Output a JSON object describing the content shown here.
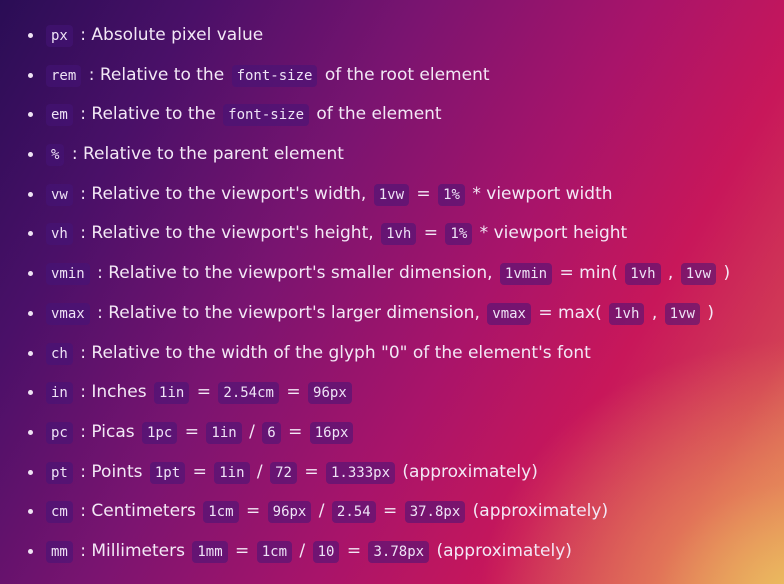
{
  "units": [
    {
      "parts": [
        {
          "t": "code",
          "v": "px"
        },
        {
          "t": "text",
          "v": " : Absolute pixel value"
        }
      ]
    },
    {
      "parts": [
        {
          "t": "code",
          "v": "rem"
        },
        {
          "t": "text",
          "v": " : Relative to the "
        },
        {
          "t": "code",
          "v": "font-size"
        },
        {
          "t": "text",
          "v": " of the root element"
        }
      ]
    },
    {
      "parts": [
        {
          "t": "code",
          "v": "em"
        },
        {
          "t": "text",
          "v": " : Relative to the "
        },
        {
          "t": "code",
          "v": "font-size"
        },
        {
          "t": "text",
          "v": " of the element"
        }
      ]
    },
    {
      "parts": [
        {
          "t": "code",
          "v": "%"
        },
        {
          "t": "text",
          "v": " : Relative to the parent element"
        }
      ]
    },
    {
      "parts": [
        {
          "t": "code",
          "v": "vw"
        },
        {
          "t": "text",
          "v": " : Relative to the viewport's width, "
        },
        {
          "t": "code",
          "v": "1vw"
        },
        {
          "t": "text",
          "v": " = "
        },
        {
          "t": "code",
          "v": "1%"
        },
        {
          "t": "text",
          "v": " * viewport width"
        }
      ]
    },
    {
      "parts": [
        {
          "t": "code",
          "v": "vh"
        },
        {
          "t": "text",
          "v": " : Relative to the viewport's height, "
        },
        {
          "t": "code",
          "v": "1vh"
        },
        {
          "t": "text",
          "v": " = "
        },
        {
          "t": "code",
          "v": "1%"
        },
        {
          "t": "text",
          "v": " * viewport height"
        }
      ]
    },
    {
      "parts": [
        {
          "t": "code",
          "v": "vmin"
        },
        {
          "t": "text",
          "v": " : Relative to the viewport's smaller dimension, "
        },
        {
          "t": "code",
          "v": "1vmin"
        },
        {
          "t": "text",
          "v": " = min( "
        },
        {
          "t": "code",
          "v": "1vh"
        },
        {
          "t": "text",
          "v": " , "
        },
        {
          "t": "code",
          "v": "1vw"
        },
        {
          "t": "text",
          "v": " )"
        }
      ]
    },
    {
      "parts": [
        {
          "t": "code",
          "v": "vmax"
        },
        {
          "t": "text",
          "v": " : Relative to the viewport's larger dimension, "
        },
        {
          "t": "code",
          "v": "vmax"
        },
        {
          "t": "text",
          "v": " = max( "
        },
        {
          "t": "code",
          "v": "1vh"
        },
        {
          "t": "text",
          "v": " , "
        },
        {
          "t": "code",
          "v": "1vw"
        },
        {
          "t": "text",
          "v": " )"
        }
      ]
    },
    {
      "parts": [
        {
          "t": "code",
          "v": "ch"
        },
        {
          "t": "text",
          "v": " : Relative to the width of the glyph \"0\" of the element's font"
        }
      ]
    },
    {
      "parts": [
        {
          "t": "code",
          "v": "in"
        },
        {
          "t": "text",
          "v": " : Inches "
        },
        {
          "t": "code",
          "v": "1in"
        },
        {
          "t": "text",
          "v": " = "
        },
        {
          "t": "code",
          "v": "2.54cm"
        },
        {
          "t": "text",
          "v": " = "
        },
        {
          "t": "code",
          "v": "96px"
        }
      ]
    },
    {
      "parts": [
        {
          "t": "code",
          "v": "pc"
        },
        {
          "t": "text",
          "v": " : Picas "
        },
        {
          "t": "code",
          "v": "1pc"
        },
        {
          "t": "text",
          "v": " = "
        },
        {
          "t": "code",
          "v": "1in"
        },
        {
          "t": "text",
          "v": " / "
        },
        {
          "t": "code",
          "v": "6"
        },
        {
          "t": "text",
          "v": " = "
        },
        {
          "t": "code",
          "v": "16px"
        }
      ]
    },
    {
      "parts": [
        {
          "t": "code",
          "v": "pt"
        },
        {
          "t": "text",
          "v": " : Points "
        },
        {
          "t": "code",
          "v": "1pt"
        },
        {
          "t": "text",
          "v": " = "
        },
        {
          "t": "code",
          "v": "1in"
        },
        {
          "t": "text",
          "v": " / "
        },
        {
          "t": "code",
          "v": "72"
        },
        {
          "t": "text",
          "v": " = "
        },
        {
          "t": "code",
          "v": "1.333px"
        },
        {
          "t": "text",
          "v": " (approximately)"
        }
      ]
    },
    {
      "parts": [
        {
          "t": "code",
          "v": "cm"
        },
        {
          "t": "text",
          "v": " : Centimeters "
        },
        {
          "t": "code",
          "v": "1cm"
        },
        {
          "t": "text",
          "v": " = "
        },
        {
          "t": "code",
          "v": "96px"
        },
        {
          "t": "text",
          "v": " / "
        },
        {
          "t": "code",
          "v": "2.54"
        },
        {
          "t": "text",
          "v": " = "
        },
        {
          "t": "code",
          "v": "37.8px"
        },
        {
          "t": "text",
          "v": " (approximately)"
        }
      ]
    },
    {
      "parts": [
        {
          "t": "code",
          "v": "mm"
        },
        {
          "t": "text",
          "v": " : Millimeters "
        },
        {
          "t": "code",
          "v": "1mm"
        },
        {
          "t": "text",
          "v": " = "
        },
        {
          "t": "code",
          "v": "1cm"
        },
        {
          "t": "text",
          "v": " / "
        },
        {
          "t": "code",
          "v": "10"
        },
        {
          "t": "text",
          "v": " = "
        },
        {
          "t": "code",
          "v": "3.78px"
        },
        {
          "t": "text",
          "v": " (approximately)"
        }
      ]
    }
  ]
}
